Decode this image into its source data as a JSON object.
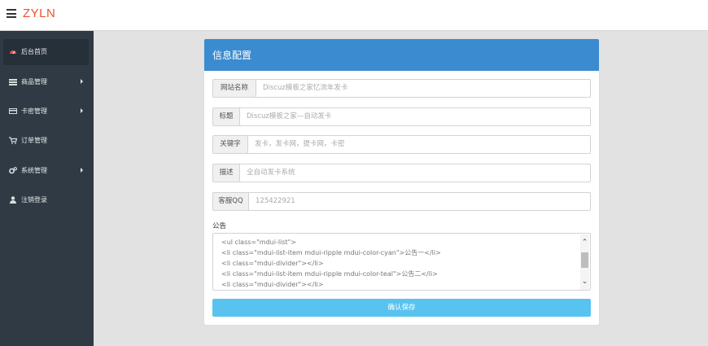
{
  "header": {
    "brand": "ZYLN"
  },
  "sidebar": {
    "items": [
      {
        "label": "后台首页",
        "icon": "dashboard-icon",
        "active": true
      },
      {
        "label": "商品管理",
        "icon": "list-icon",
        "has_submenu": true
      },
      {
        "label": "卡密管理",
        "icon": "card-icon",
        "has_submenu": true
      },
      {
        "label": "订单管理",
        "icon": "cart-icon"
      },
      {
        "label": "系统管理",
        "icon": "gears-icon",
        "has_submenu": true
      },
      {
        "label": "注销登录",
        "icon": "user-icon"
      }
    ]
  },
  "form": {
    "title": "信息配置",
    "fields": [
      {
        "label": "网站名称",
        "placeholder": "Discuz模板之家忆流年发卡"
      },
      {
        "label": "标题",
        "placeholder": "Discuz模板之家—自动发卡"
      },
      {
        "label": "关键字",
        "placeholder": "发卡，发卡网，提卡网，卡密"
      },
      {
        "label": "描述",
        "placeholder": "全自动发卡系统"
      },
      {
        "label": "客服QQ",
        "placeholder": "125422921"
      }
    ],
    "notice_label": "公告",
    "notice_lines": [
      "<ul class=\"mdui-list\">",
      "  <li class=\"mdui-list-item mdui-ripple mdui-color-cyan\">公告一</li>",
      "<li class=\"mdui-divider\"></li>",
      "  <li class=\"mdui-list-item mdui-ripple mdui-color-teal\">公告二</li>",
      "<li class=\"mdui-divider\"></li>"
    ],
    "save_label": "确认保存"
  },
  "colors": {
    "brand": "#f0502e",
    "sidebar_bg": "#2f3a44",
    "header_bar": "#3b8bd0",
    "save_button": "#58c3ef",
    "page_bg": "#e2e2e2"
  }
}
